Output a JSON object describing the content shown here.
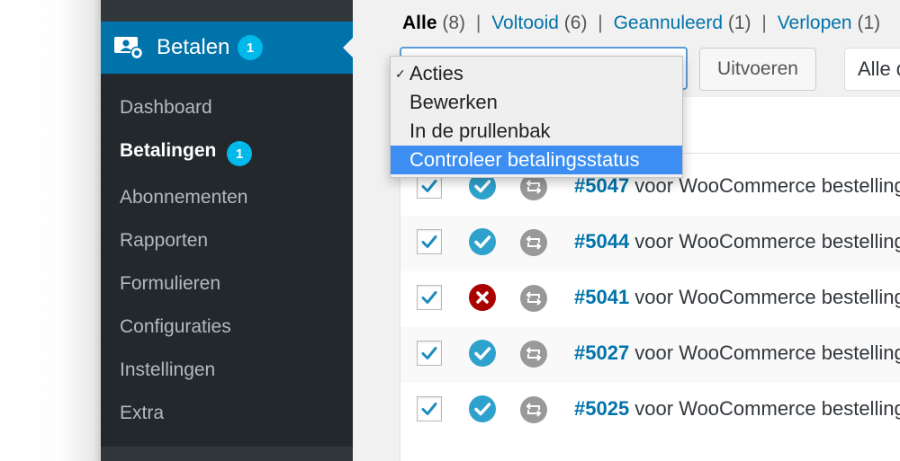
{
  "sidebar": {
    "main_item": {
      "label": "Betalen",
      "badge": "1"
    },
    "items": [
      {
        "label": "Dashboard"
      },
      {
        "label": "Betalingen",
        "badge": "1"
      },
      {
        "label": "Abonnementen"
      },
      {
        "label": "Rapporten"
      },
      {
        "label": "Formulieren"
      },
      {
        "label": "Configuraties"
      },
      {
        "label": "Instellingen"
      },
      {
        "label": "Extra"
      }
    ]
  },
  "filters": [
    {
      "label": "Alle",
      "count": "(8)"
    },
    {
      "label": "Voltooid",
      "count": "(6)"
    },
    {
      "label": "Geannuleerd",
      "count": "(1)"
    },
    {
      "label": "Verlopen",
      "count": "(1)"
    }
  ],
  "bulk_actions": {
    "options": [
      "Acties",
      "Bewerken",
      "In de prullenbak",
      "Controleer betalingsstatus"
    ],
    "checked": "Acties",
    "highlighted": "Controleer betalingsstatus",
    "apply_label": "Uitvoeren",
    "filter_select_value": "Alle d"
  },
  "rows": [
    {
      "number": "#5047",
      "text": " voor WooCommerce bestelling",
      "status": "completed"
    },
    {
      "number": "#5044",
      "text": " voor WooCommerce bestelling",
      "status": "completed"
    },
    {
      "number": "#5041",
      "text": " voor WooCommerce bestelling",
      "status": "cancelled"
    },
    {
      "number": "#5027",
      "text": " voor WooCommerce bestelling",
      "status": "completed"
    },
    {
      "number": "#5025",
      "text": " voor WooCommerce bestelling",
      "status": "completed"
    }
  ],
  "colors": {
    "sidebar_bg": "#23282d",
    "active_bg": "#0073aa",
    "badge": "#00b9eb",
    "link": "#0073aa",
    "status_ok": "#2ea2cc",
    "status_cancel": "#a00",
    "highlight": "#3c8ef2"
  },
  "icons": {
    "menu": "payment-user-icon",
    "status_ok": "check-circle-icon",
    "status_cancel": "x-circle-icon",
    "recurring": "recurring-icon",
    "checkbox": "checkmark-icon"
  }
}
